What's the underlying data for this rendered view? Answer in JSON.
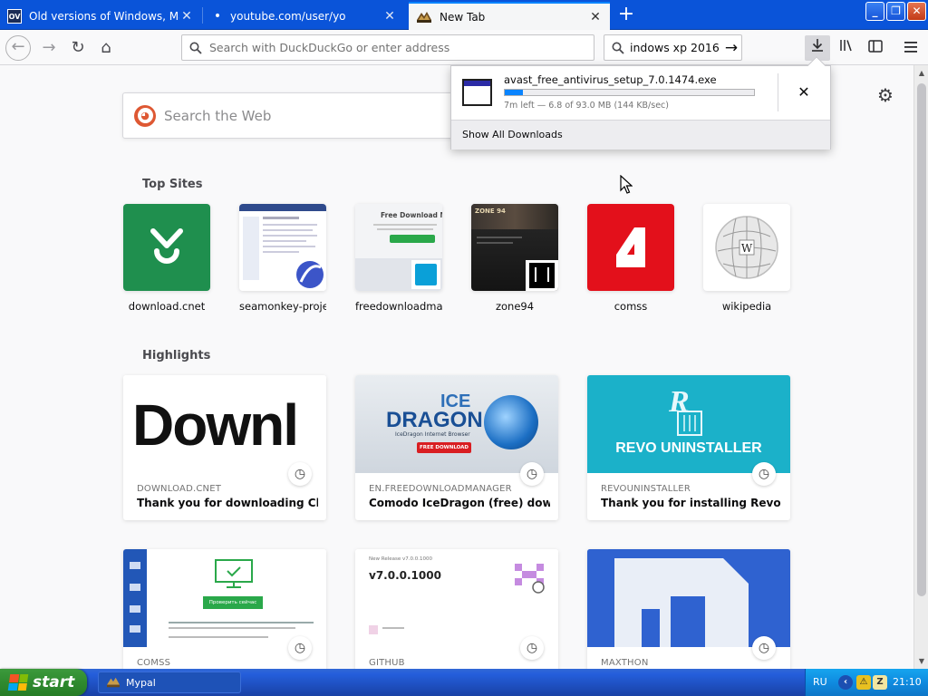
{
  "browser": {
    "tabs": [
      {
        "title": "Old versions of Windows, Mac and",
        "favicon": "ov-favicon",
        "active": false
      },
      {
        "title": "youtube.com/user/yo",
        "favicon": "dot-favicon",
        "active": false
      },
      {
        "title": "New Tab",
        "favicon": "firefox-favicon",
        "active": true
      }
    ],
    "new_tab_symbol": "+",
    "window_buttons": {
      "minimize": "_",
      "restore": "❐",
      "close": "✕"
    }
  },
  "navbar": {
    "url_placeholder": "Search with DuckDuckGo or enter address",
    "search_value": "indows xp 2016",
    "search_go": "→"
  },
  "newtab": {
    "search_placeholder": "Search the Web",
    "top_sites_title": "Top Sites",
    "highlights_title": "Highlights",
    "top_sites": [
      {
        "label": "download.cnet"
      },
      {
        "label": "seamonkey-project"
      },
      {
        "label": "freedownloadman..."
      },
      {
        "label": "zone94"
      },
      {
        "label": "comss"
      },
      {
        "label": "wikipedia"
      }
    ],
    "previews": {
      "fdm_heading": "Free Download Mac",
      "zone_logo": "ZONE 94",
      "download_word": "Downl",
      "ice": "ICE",
      "dragon": "DRAGON",
      "icedragon_sub": "IceDragon Internet Browser",
      "free_download": "FREE DOWNLOAD",
      "revo_banner": "REVO UNINSTALLER",
      "github_version": "v7.0.0.1000",
      "github_release": "New Release v7.0.0.1000",
      "comss_button": "Проверить сейчас"
    },
    "highlights": [
      {
        "host": "DOWNLOAD.CNET",
        "title": "Thank you for downloading Clea..."
      },
      {
        "host": "EN.FREEDOWNLOADMANAGER",
        "title": "Comodo IceDragon (free) downl..."
      },
      {
        "host": "REVOUNINSTALLER",
        "title": "Thank you for installing Revo Un..."
      },
      {
        "host": "COMSS",
        "title": ""
      },
      {
        "host": "GITHUB",
        "title": ""
      },
      {
        "host": "MAXTHON",
        "title": ""
      }
    ]
  },
  "downloads": {
    "file_name": "avast_free_antivirus_setup_7.0.1474.exe",
    "status": "7m left — 6.8 of 93.0 MB (144 KB/sec)",
    "progress": 0.073,
    "cancel_symbol": "✕",
    "show_all": "Show All Downloads"
  },
  "taskbar": {
    "start_label": "start",
    "task_label": "Mypal",
    "lang": "RU",
    "time": "21:10"
  },
  "colors": {
    "tab_strip": "#0a54d9",
    "accent": "#0a84ff",
    "cnet_green": "#1f8f4e",
    "comss_red": "#e3101b",
    "revo_teal": "#1bb1c9"
  }
}
